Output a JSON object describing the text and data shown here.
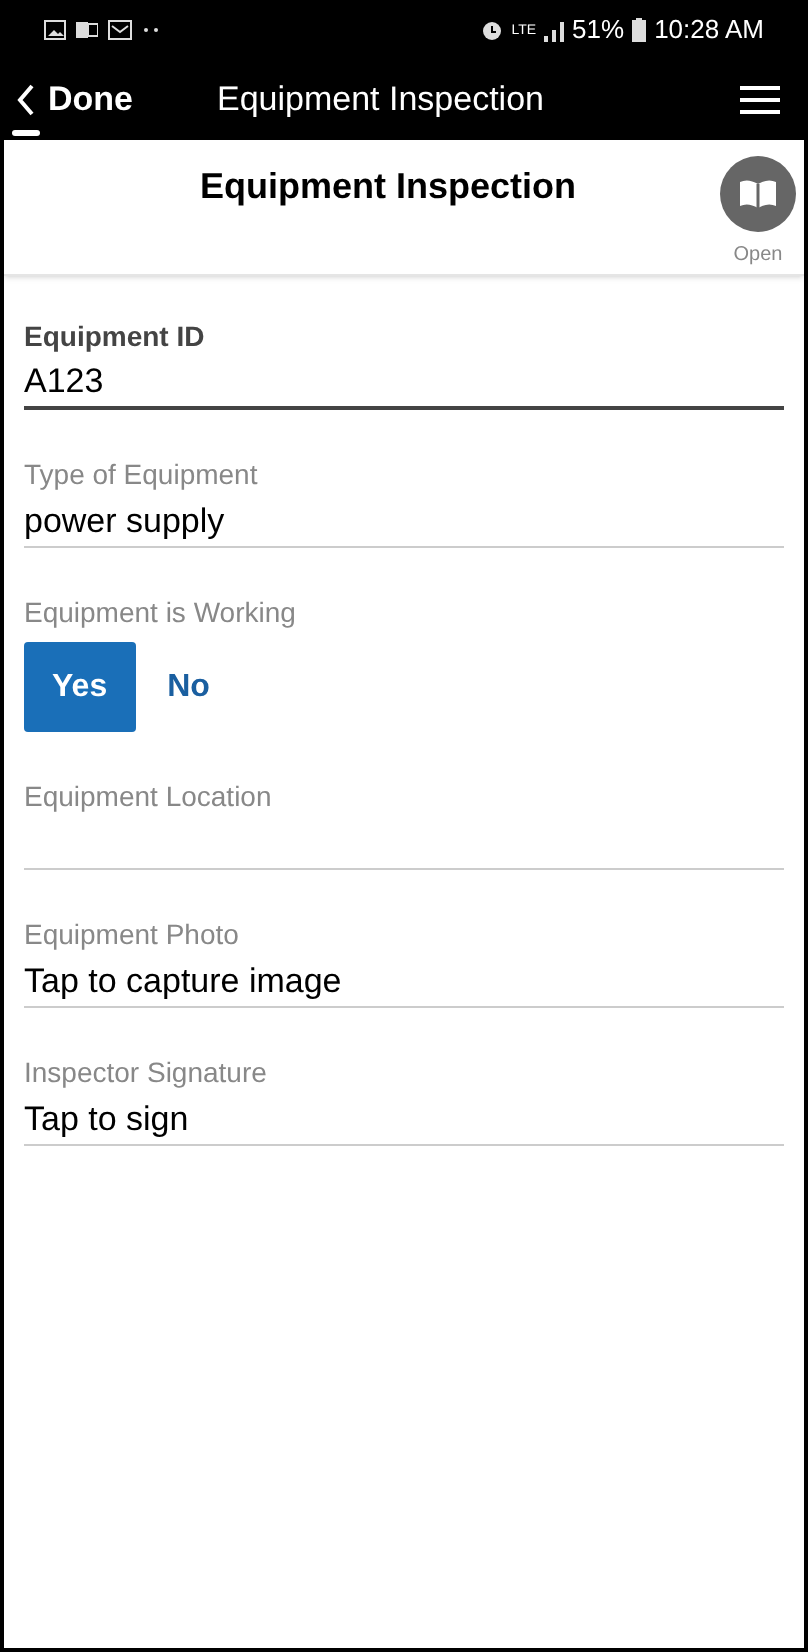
{
  "status_bar": {
    "battery": "51%",
    "time": "10:28 AM",
    "network": "LTE"
  },
  "header": {
    "back_label": "Done",
    "title": "Equipment Inspection"
  },
  "form": {
    "title": "Equipment Inspection",
    "open_label": "Open",
    "fields": [
      {
        "kind": "text",
        "label": "Equipment ID",
        "value": "A123",
        "focused": true
      },
      {
        "kind": "text",
        "label": "Type of Equipment",
        "value": "power supply",
        "focused": false
      },
      {
        "kind": "choice",
        "label": "Equipment is Working",
        "options": [
          {
            "label": "Yes",
            "selected": true
          },
          {
            "label": "No",
            "selected": false
          }
        ]
      },
      {
        "kind": "text",
        "label": "Equipment Location",
        "focused": false
      },
      {
        "kind": "text",
        "label": "Equipment Photo",
        "value": "Tap to capture image",
        "focused": false
      },
      {
        "kind": "text",
        "label": "Inspector Signature",
        "value": "Tap to sign",
        "focused": false
      }
    ]
  }
}
